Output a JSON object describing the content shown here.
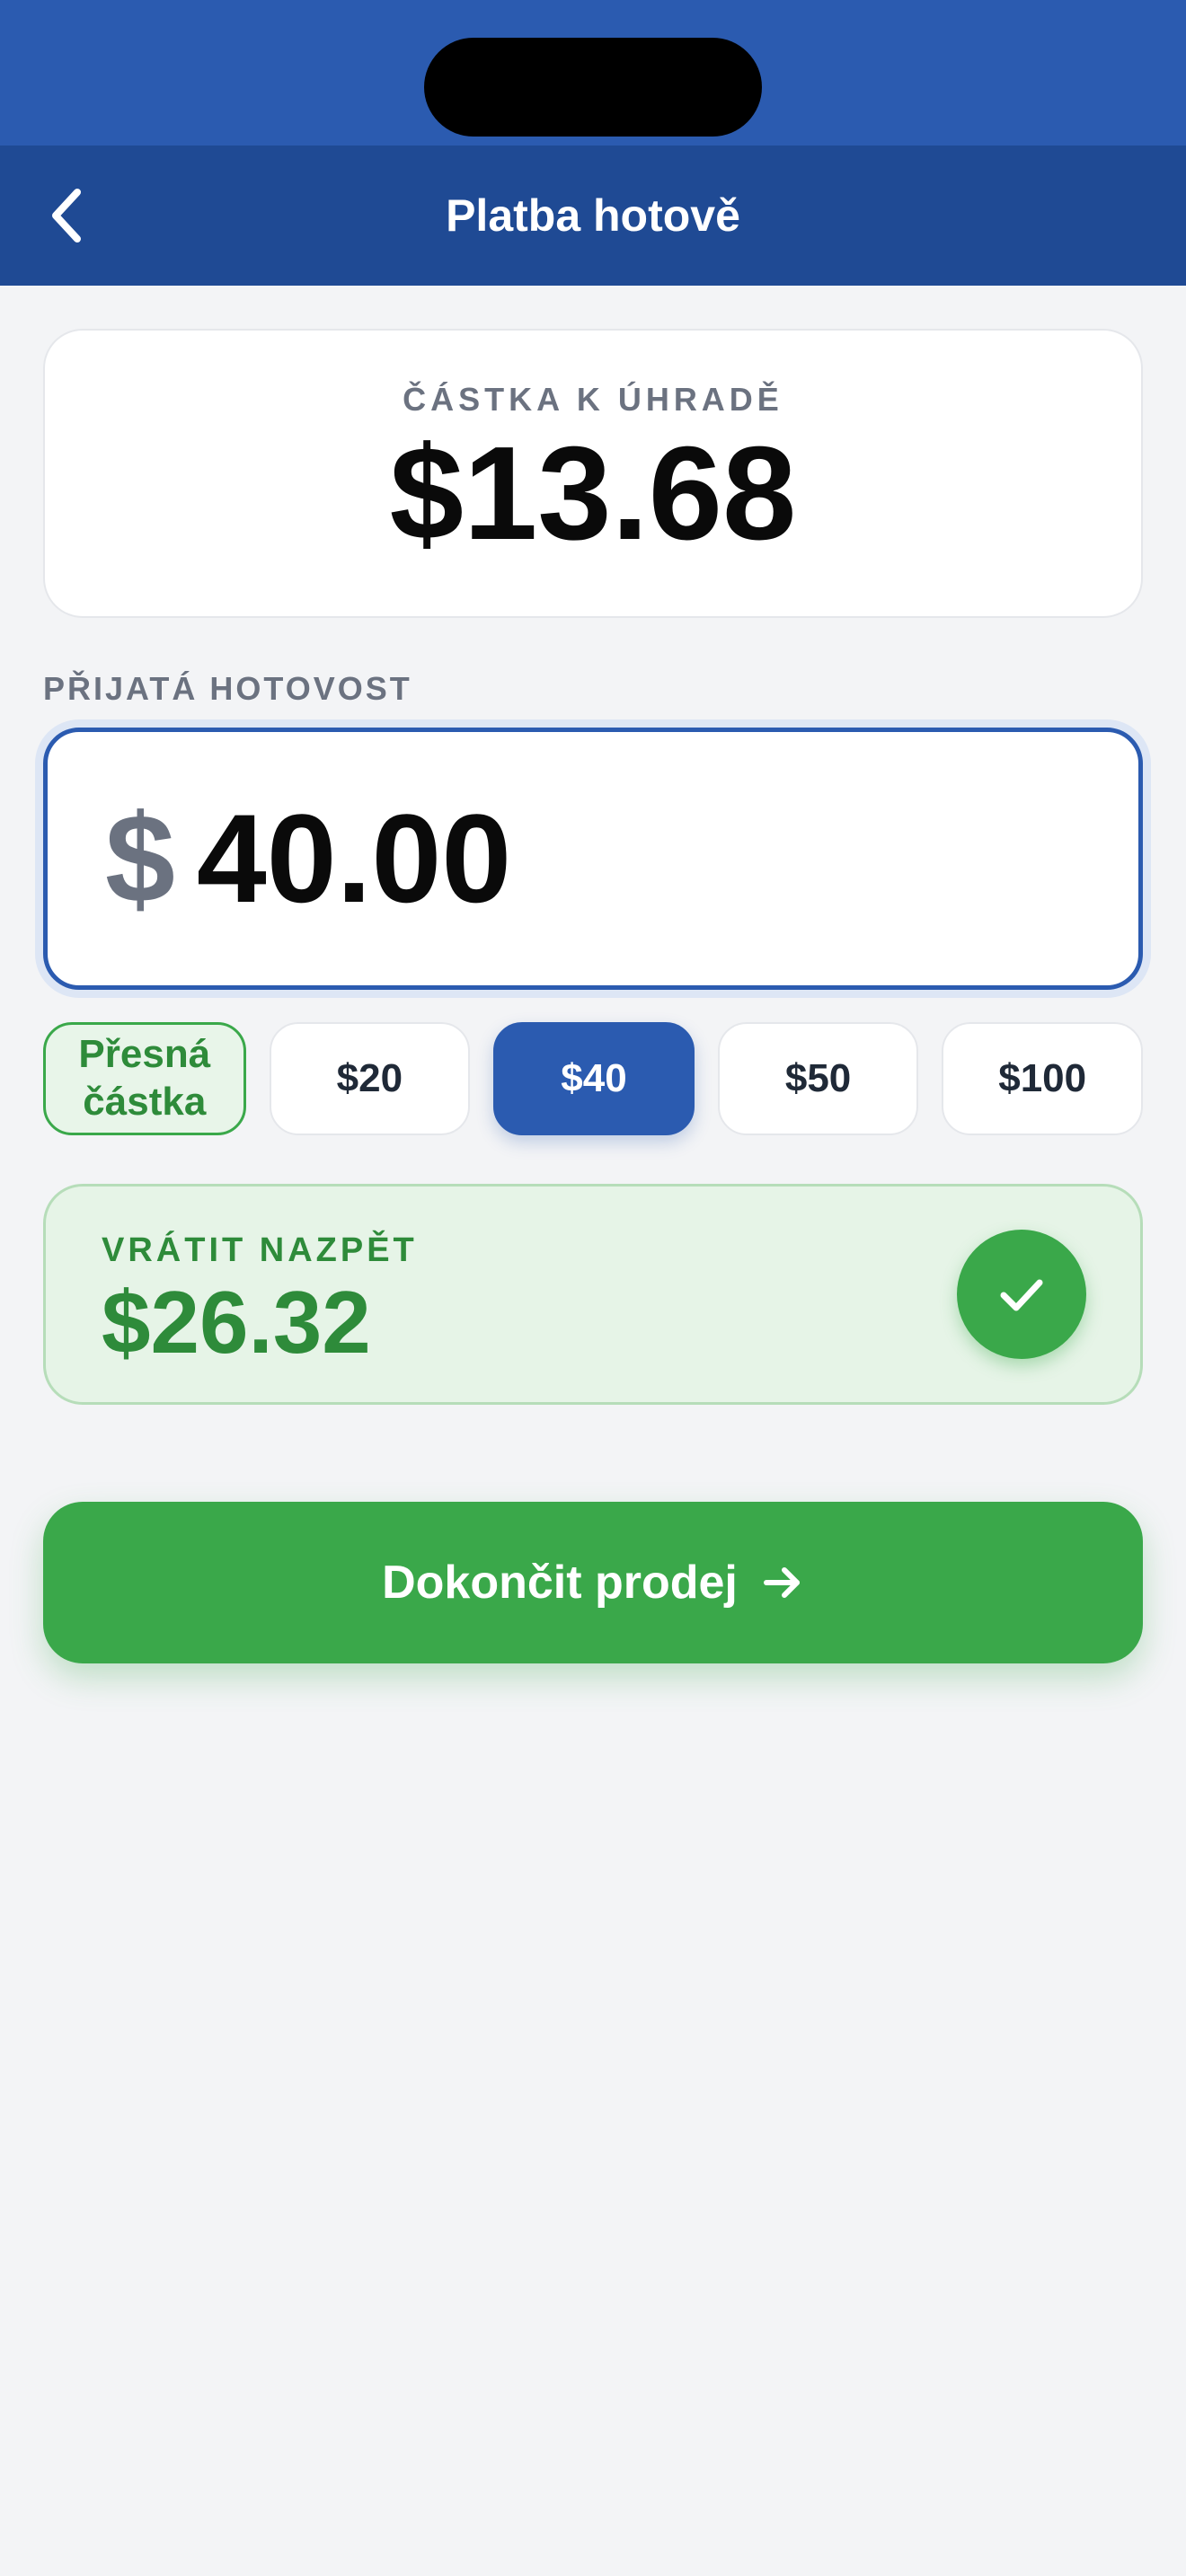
{
  "header": {
    "title": "Platba hotově"
  },
  "amount_due": {
    "label": "ČÁSTKA K ÚHRADĚ",
    "value": "$13.68"
  },
  "cash_received": {
    "label": "PŘIJATÁ HOTOVOST",
    "currency_symbol": "$",
    "value": "40.00"
  },
  "quick_amounts": {
    "exact_line1": "Přesná",
    "exact_line2": "částka",
    "options": [
      "$20",
      "$40",
      "$50",
      "$100"
    ],
    "selected": "$40"
  },
  "change": {
    "label": "VRÁTIT NAZPĚT",
    "value": "$26.32"
  },
  "actions": {
    "complete_label": "Dokončit prodej"
  },
  "colors": {
    "primary": "#2B5BB0",
    "header": "#1F4A94",
    "success": "#3AA84A",
    "success_text": "#2E8B3A"
  },
  "icons": {
    "back": "chevron-left-icon",
    "check": "check-icon",
    "arrow": "arrow-right-icon"
  }
}
